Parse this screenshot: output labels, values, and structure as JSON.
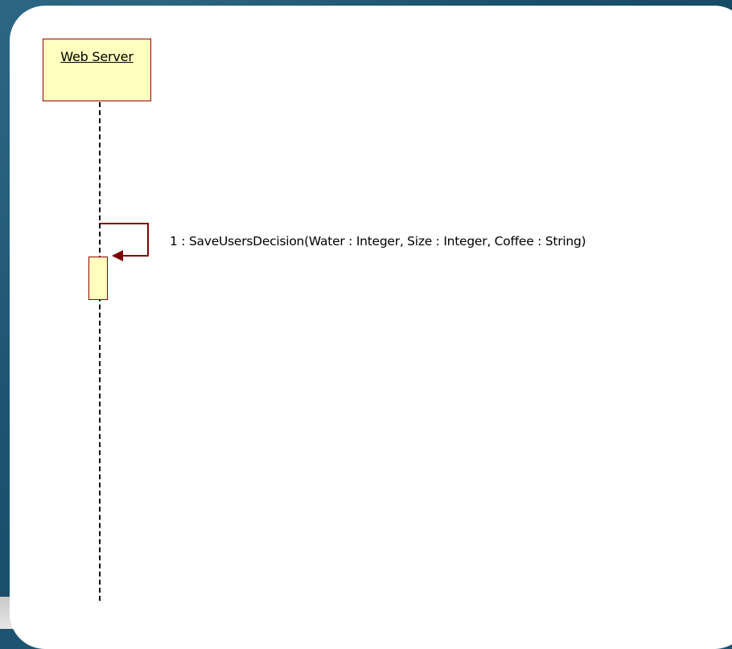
{
  "diagram": {
    "type": "sequence",
    "lifeline": {
      "name": "Web Server"
    },
    "message": {
      "label": "1 : SaveUsersDecision(Water : Integer, Size : Integer, Coffee : String)",
      "kind": "self-call"
    },
    "colors": {
      "box_fill": "#ffffc0",
      "box_border": "#990000",
      "arrow": "#800000",
      "background": "#1d5472"
    }
  }
}
